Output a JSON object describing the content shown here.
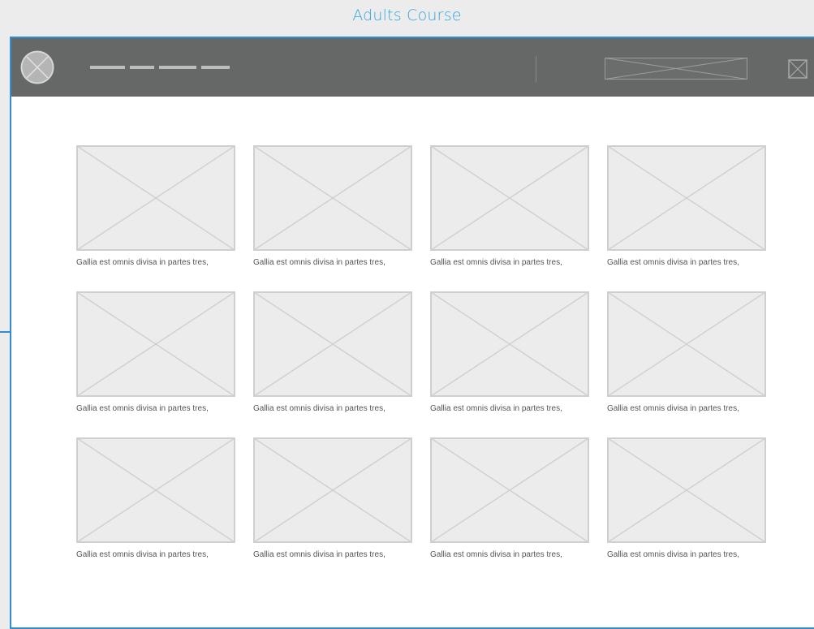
{
  "page": {
    "title": "Adults Course"
  },
  "header": {
    "logo_icon": "image-placeholder-circle-icon",
    "nav_dash_count": 4,
    "banner_icon": "image-placeholder-icon",
    "close_icon": "close-box-icon"
  },
  "colors": {
    "accent": "#2e8ed1",
    "title": "#33a6e0",
    "toolbar": "#666767",
    "placeholder_fill": "#ececec",
    "placeholder_stroke": "#cfcfcf"
  },
  "gallery": {
    "items": [
      {
        "caption": "Gallia est omnis divisa in partes tres,"
      },
      {
        "caption": "Gallia est omnis divisa in partes tres,"
      },
      {
        "caption": "Gallia est omnis divisa in partes tres,"
      },
      {
        "caption": "Gallia est omnis divisa in partes tres,"
      },
      {
        "caption": "Gallia est omnis divisa in partes tres,"
      },
      {
        "caption": "Gallia est omnis divisa in partes tres,"
      },
      {
        "caption": "Gallia est omnis divisa in partes tres,"
      },
      {
        "caption": "Gallia est omnis divisa in partes tres,"
      },
      {
        "caption": "Gallia est omnis divisa in partes tres,"
      },
      {
        "caption": "Gallia est omnis divisa in partes tres,"
      },
      {
        "caption": "Gallia est omnis divisa in partes tres,"
      },
      {
        "caption": "Gallia est omnis divisa in partes tres,"
      }
    ]
  }
}
